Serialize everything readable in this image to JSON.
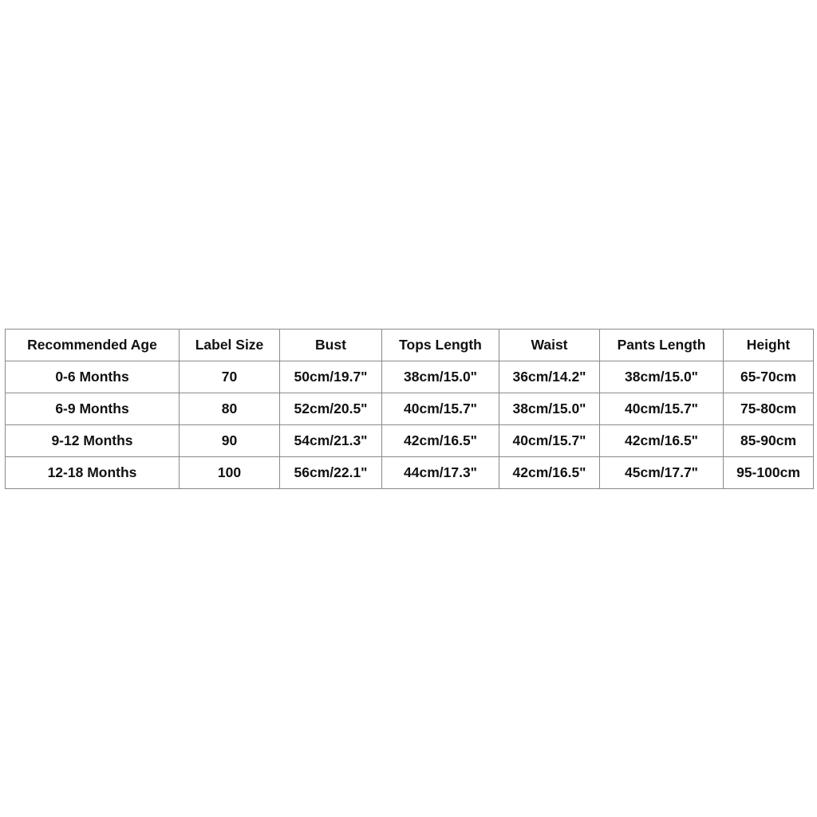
{
  "size_chart": {
    "headers": [
      "Recommended Age",
      "Label Size",
      "Bust",
      "Tops Length",
      "Waist",
      "Pants Length",
      "Height"
    ],
    "rows": [
      [
        "0-6 Months",
        "70",
        "50cm/19.7\"",
        "38cm/15.0\"",
        "36cm/14.2\"",
        "38cm/15.0\"",
        "65-70cm"
      ],
      [
        "6-9 Months",
        "80",
        "52cm/20.5\"",
        "40cm/15.7\"",
        "38cm/15.0\"",
        "40cm/15.7\"",
        "75-80cm"
      ],
      [
        "9-12 Months",
        "90",
        "54cm/21.3\"",
        "42cm/16.5\"",
        "40cm/15.7\"",
        "42cm/16.5\"",
        "85-90cm"
      ],
      [
        "12-18 Months",
        "100",
        "56cm/22.1\"",
        "44cm/17.3\"",
        "42cm/16.5\"",
        "45cm/17.7\"",
        "95-100cm"
      ]
    ]
  }
}
